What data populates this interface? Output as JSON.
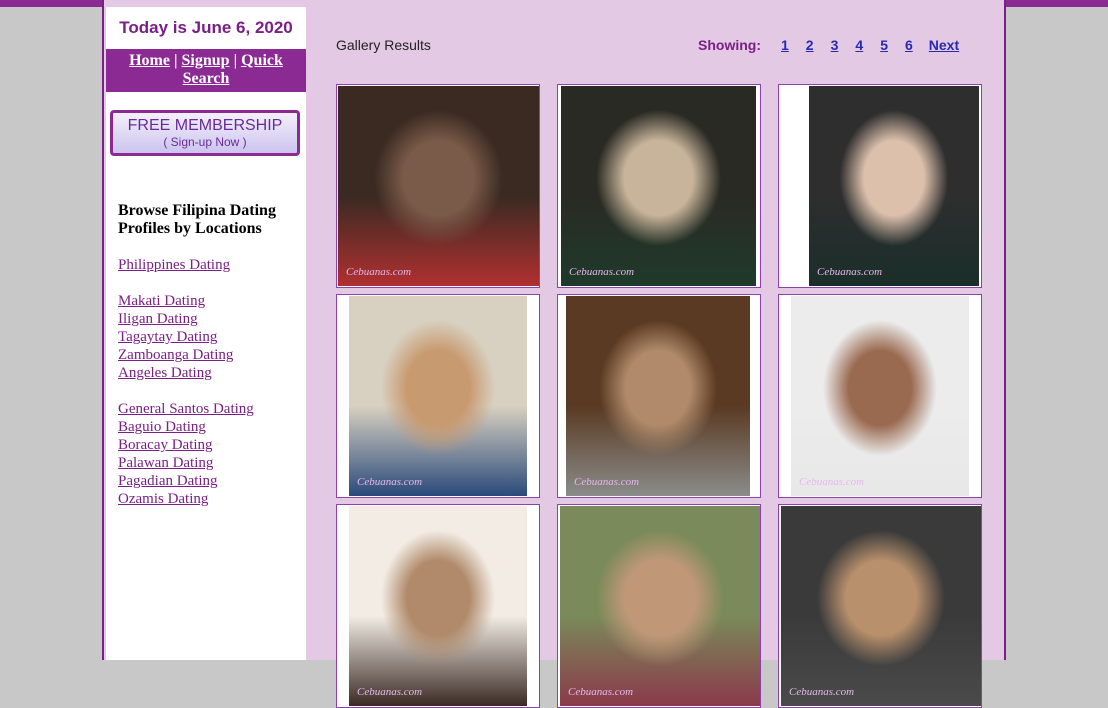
{
  "sidebar": {
    "date_text": "Today is June 6, 2020",
    "nav": {
      "home": "Home",
      "sep1": "|",
      "signup": "Signup",
      "sep2": "|",
      "quick_search": "Quick Search"
    },
    "membership": {
      "line1": "FREE MEMBERSHIP",
      "line2": "( Sign-up Now )"
    },
    "browse_heading": "Browse Filipina Dating Profiles by Locations",
    "location_groups": [
      [
        "Philippines Dating"
      ],
      [
        "Makati Dating",
        "Iligan Dating",
        "Tagaytay Dating",
        "Zamboanga Dating",
        "Angeles Dating"
      ],
      [
        "General Santos Dating",
        "Baguio Dating",
        "Boracay Dating",
        "Palawan Dating",
        "Pagadian Dating",
        "Ozamis Dating"
      ]
    ]
  },
  "main": {
    "gallery_title": "Gallery Results",
    "pager": {
      "showing_label": "Showing:",
      "pages": [
        "1",
        "2",
        "3",
        "4",
        "5",
        "6"
      ],
      "next_label": "Next"
    },
    "watermark": "Cebuanas.com",
    "photos": [
      {
        "colors": [
          "#3a2a22",
          "#7a5a48",
          "#b03030"
        ]
      },
      {
        "colors": [
          "#2a2a24",
          "#c8b49a",
          "#1e3a2a"
        ]
      },
      {
        "colors": [
          "#2e2e2e",
          "#dcc0ac",
          "#1a2e2a"
        ]
      },
      {
        "colors": [
          "#d8d0c0",
          "#c89a70",
          "#2a4a7a"
        ]
      },
      {
        "colors": [
          "#5a3a22",
          "#b08a6a",
          "#8a8c8a"
        ]
      },
      {
        "colors": [
          "#ececec",
          "#9a6a50",
          "#e8e8e8"
        ]
      },
      {
        "colors": [
          "#f2ece4",
          "#b08a6a",
          "#3a2a24"
        ]
      },
      {
        "colors": [
          "#7a8a5a",
          "#c09878",
          "#8a3a4a"
        ]
      },
      {
        "colors": [
          "#3a3a3a",
          "#b8906c",
          "#4a4a4a"
        ]
      }
    ]
  }
}
